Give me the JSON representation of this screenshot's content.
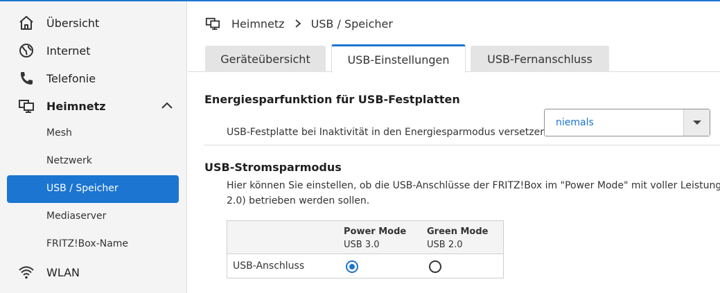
{
  "sidebar": {
    "items": [
      {
        "label": "Übersicht",
        "icon": "home-icon"
      },
      {
        "label": "Internet",
        "icon": "globe-icon"
      },
      {
        "label": "Telefonie",
        "icon": "phone-icon"
      },
      {
        "label": "Heimnetz",
        "icon": "monitor-network-icon",
        "expanded": true
      },
      {
        "label": "WLAN",
        "icon": "wifi-icon"
      }
    ],
    "subitems": [
      {
        "label": "Mesh"
      },
      {
        "label": "Netzwerk"
      },
      {
        "label": "USB / Speicher",
        "active": true
      },
      {
        "label": "Mediaserver"
      },
      {
        "label": "FRITZ!Box-Name"
      }
    ]
  },
  "breadcrumb": {
    "parent": "Heimnetz",
    "current": "USB / Speicher"
  },
  "tabs": [
    {
      "label": "Geräteübersicht"
    },
    {
      "label": "USB-Einstellungen",
      "active": true
    },
    {
      "label": "USB-Fernanschluss"
    }
  ],
  "energy": {
    "heading": "Energiesparfunktion für USB-Festplatten",
    "label": "USB-Festplatte bei Inaktivität in den Energiesparmodus versetzen:",
    "selected": "niemals"
  },
  "power": {
    "heading": "USB-Stromsparmodus",
    "line1": "Hier können Sie einstellen, ob die USB-Anschlüsse der FRITZ!Box im \"Power Mode\" mit voller Leistung (U",
    "line2": "2.0) betrieben werden sollen.",
    "table": {
      "col1_title": "Power Mode",
      "col1_sub": "USB 3.0",
      "col2_title": "Green Mode",
      "col2_sub": "USB 2.0",
      "row_label": "USB-Anschluss",
      "selected": "Power Mode"
    }
  },
  "colors": {
    "accent": "#1b75d1",
    "sidebar_bg": "#f4f4f4"
  }
}
